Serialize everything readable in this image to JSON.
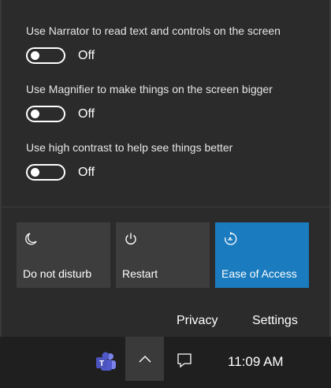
{
  "options": [
    {
      "label": "Use Narrator to read text and controls on the screen",
      "state": "Off"
    },
    {
      "label": "Use Magnifier to make things on the screen bigger",
      "state": "Off"
    },
    {
      "label": "Use high contrast to help see things better",
      "state": "Off"
    }
  ],
  "tiles": [
    {
      "label": "Do not disturb",
      "icon": "moon-icon"
    },
    {
      "label": "Restart",
      "icon": "power-icon"
    },
    {
      "label": "Ease of Access",
      "icon": "ease-of-access-icon",
      "active": true
    }
  ],
  "links": {
    "privacy": "Privacy",
    "settings": "Settings"
  },
  "taskbar": {
    "time": "11:09 AM",
    "icons": [
      "teams-icon",
      "chevron-up-icon",
      "notification-icon"
    ]
  },
  "colors": {
    "panel": "#2b2b2b",
    "tile": "#3d3d3d",
    "accent": "#1a7bbf",
    "taskbar": "#1f1f1f"
  }
}
